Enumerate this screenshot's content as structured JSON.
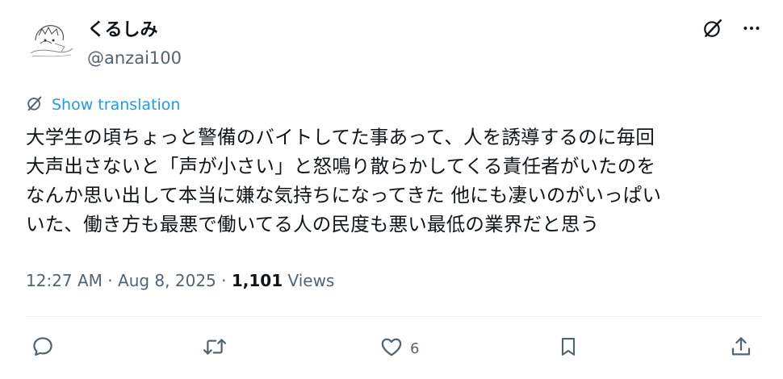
{
  "header": {
    "display_name": "くるしみ",
    "handle": "@anzai100"
  },
  "translation": {
    "label": "Show translation"
  },
  "tweet": {
    "lines": [
      "大学生の頃ちょっと警備のバイトしてた事あって、人を誘導するのに毎回",
      "大声出さないと「声が小さい」と怒鳴り散らかしてくる責任者がいたのを",
      "なんか思い出して本当に嫌な気持ちになってきた 他にも凄いのがいっぱい",
      "いた、働き方も最悪で働いてる人の民度も悪い最低の業界だと思う"
    ]
  },
  "meta": {
    "time": "12:27 AM",
    "sep1": " · ",
    "date": "Aug 8, 2025",
    "sep2": " · ",
    "views_count": "1,101",
    "views_label": " Views"
  },
  "actions": {
    "likes_count": "6"
  },
  "icons": {
    "translate": "grok-translate-icon",
    "more": "more-icon",
    "reply": "reply-icon",
    "retweet": "retweet-icon",
    "like": "heart-icon",
    "bookmark": "bookmark-icon",
    "share": "share-icon"
  },
  "colors": {
    "link": "#1d9bf0",
    "secondary": "#536471",
    "primary": "#0f1419",
    "divider": "#eff3f4"
  }
}
